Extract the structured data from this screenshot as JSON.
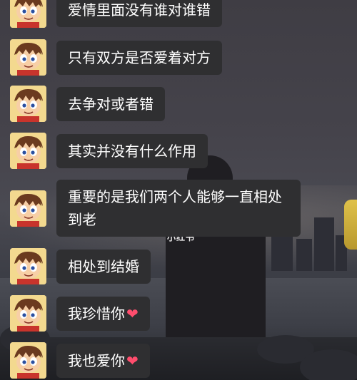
{
  "watermark": "小红书",
  "colors": {
    "bubble_bg": "#2f2f31",
    "bubble_text": "#ffffff",
    "heart": "#ff4d6d"
  },
  "messages": [
    {
      "text": "爱情里面没有谁对谁错",
      "avatar_icon": "cartoon-boy-avatar-icon"
    },
    {
      "text": "只有双方是否爱着对方",
      "avatar_icon": "cartoon-boy-avatar-icon"
    },
    {
      "text": "去争对或者错",
      "avatar_icon": "cartoon-boy-avatar-icon"
    },
    {
      "text": "其实并没有什么作用",
      "avatar_icon": "cartoon-boy-avatar-icon"
    },
    {
      "text": "重要的是我们两个人能够一直相处到老",
      "avatar_icon": "cartoon-boy-avatar-icon"
    },
    {
      "text": "相处到结婚",
      "avatar_icon": "cartoon-boy-avatar-icon"
    },
    {
      "text": "我珍惜你",
      "emoji": "❤",
      "avatar_icon": "cartoon-boy-avatar-icon"
    },
    {
      "text": "我也爱你",
      "emoji": "❤",
      "avatar_icon": "cartoon-boy-avatar-icon"
    }
  ]
}
